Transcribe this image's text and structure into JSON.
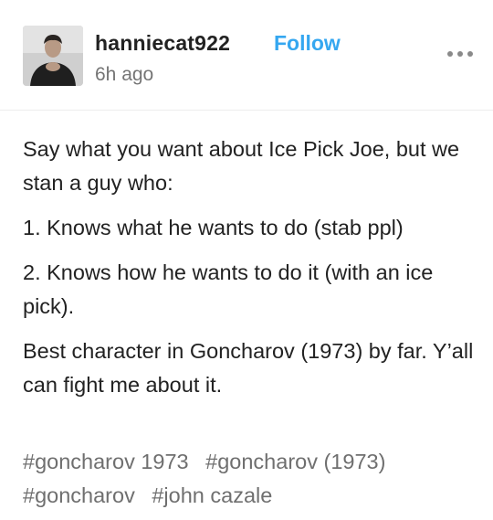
{
  "post": {
    "author": "hanniecat922",
    "follow_label": "Follow",
    "time": "6h ago",
    "more_icon": "ellipsis-icon",
    "paragraphs": [
      "Say what you want about Ice Pick Joe, but we stan a guy who:",
      "1.  Knows what he wants to do (stab ppl)",
      "2. Knows how he wants to do it (with an ice pick).",
      "Best character in Goncharov (1973) by far. Y’all can fight me about it."
    ],
    "tags": [
      "#goncharov 1973",
      "#goncharov (1973)",
      "#goncharov",
      "#john cazale"
    ]
  },
  "colors": {
    "follow": "#35a7f0",
    "tag_text": "#6f6f6f",
    "meta_text": "#757575"
  }
}
